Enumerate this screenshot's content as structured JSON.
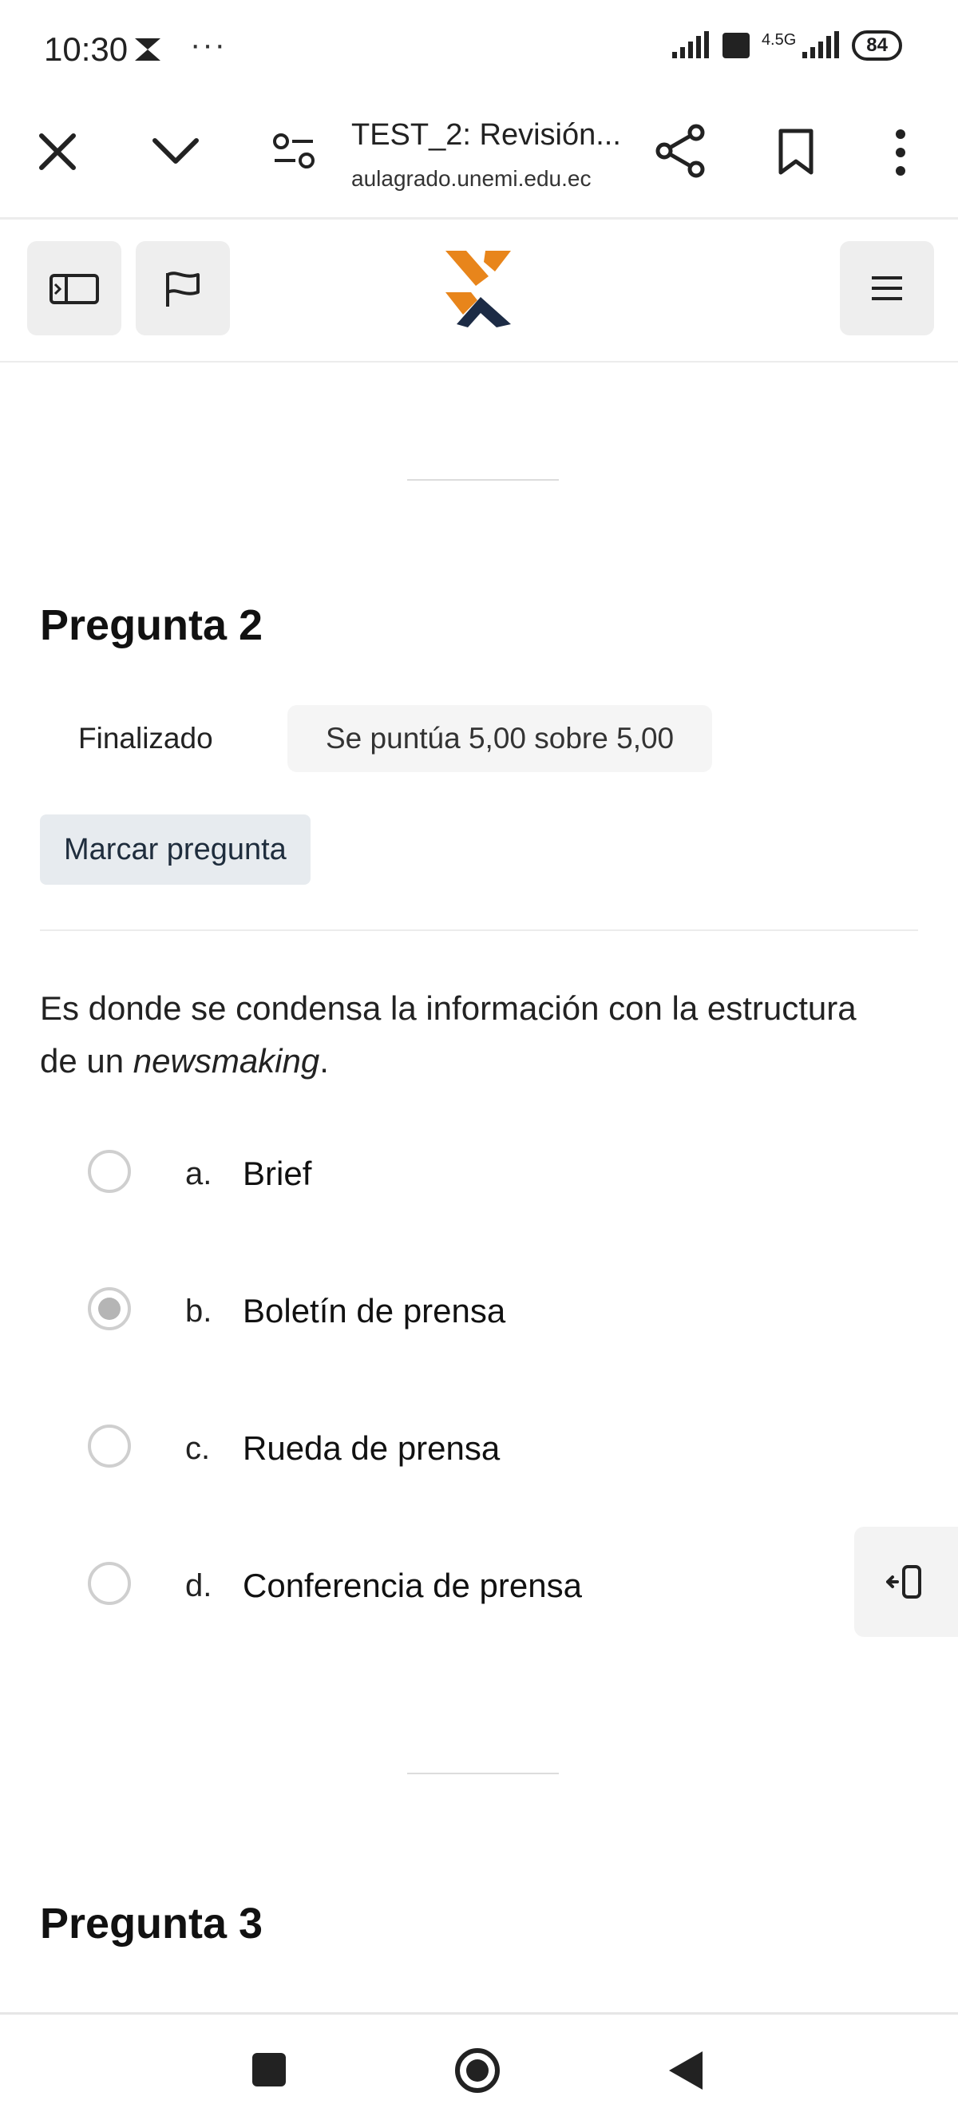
{
  "status_bar": {
    "time": "10:30",
    "dots": "···",
    "network": "4.5G",
    "battery": "84"
  },
  "browser": {
    "page_title": "TEST_2: Revisión...",
    "url": "aulagrado.unemi.edu.ec"
  },
  "question": {
    "title": "Pregunta 2",
    "state": "Finalizado",
    "grade": "Se puntúa 5,00 sobre 5,00",
    "flag_label": "Marcar pregunta",
    "text_before": "Es donde se condensa la información con la estructura de un ",
    "text_emphasis": "newsmaking",
    "text_after": ".",
    "options": [
      {
        "letter": "a.",
        "label": "Brief",
        "selected": false
      },
      {
        "letter": "b.",
        "label": "Boletín de prensa",
        "selected": true
      },
      {
        "letter": "c.",
        "label": "Rueda de prensa",
        "selected": false
      },
      {
        "letter": "d.",
        "label": "Conferencia de prensa",
        "selected": false
      }
    ]
  },
  "next_question": {
    "title": "Pregunta 3"
  },
  "colors": {
    "logo_orange": "#e8851b",
    "logo_navy": "#1c2b45"
  }
}
